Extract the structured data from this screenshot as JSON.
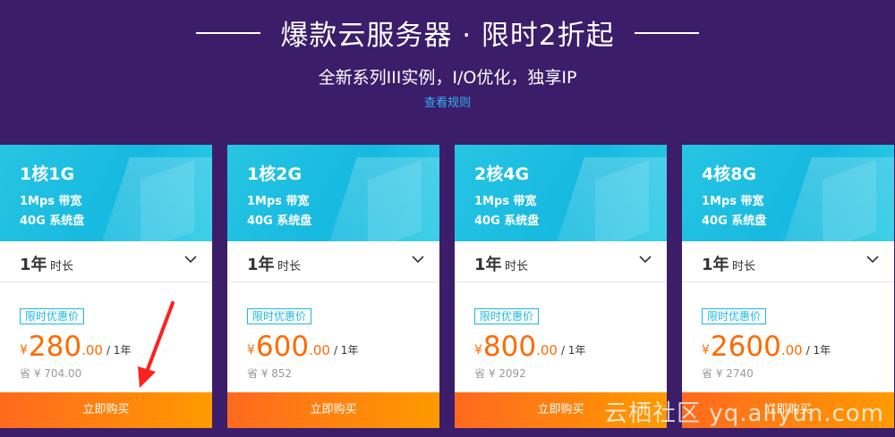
{
  "header": {
    "title": "爆款云服务器 · 限时2折起",
    "subtitle": "全新系列III实例，I/O优化，独享IP",
    "rules_link": "查看规则"
  },
  "cards": [
    {
      "spec": "1核1G",
      "bandwidth": "1Mps 带宽",
      "disk": "40G 系统盘",
      "duration_value": "1年",
      "duration_unit": "时长",
      "promo_label": "限时优惠价",
      "currency": "¥",
      "price_int": "280",
      "price_dec": ".00",
      "period": "/ 1年",
      "save_text": "省 ¥ 704.00",
      "buy_label": "立即购买"
    },
    {
      "spec": "1核2G",
      "bandwidth": "1Mps 带宽",
      "disk": "40G 系统盘",
      "duration_value": "1年",
      "duration_unit": "时长",
      "promo_label": "限时优惠价",
      "currency": "¥",
      "price_int": "600",
      "price_dec": ".00",
      "period": "/ 1年",
      "save_text": "省 ¥ 852",
      "buy_label": "立即购买"
    },
    {
      "spec": "2核4G",
      "bandwidth": "1Mps 带宽",
      "disk": "40G 系统盘",
      "duration_value": "1年",
      "duration_unit": "时长",
      "promo_label": "限时优惠价",
      "currency": "¥",
      "price_int": "800",
      "price_dec": ".00",
      "period": "/ 1年",
      "save_text": "省 ¥ 2092",
      "buy_label": "立即购买"
    },
    {
      "spec": "4核8G",
      "bandwidth": "1Mps 带宽",
      "disk": "40G 系统盘",
      "duration_value": "1年",
      "duration_unit": "时长",
      "promo_label": "限时优惠价",
      "currency": "¥",
      "price_int": "2600",
      "price_dec": ".00",
      "period": "/ 1年",
      "save_text": "省 ¥ 2740",
      "buy_label": "立即购买"
    }
  ],
  "watermark": "云栖社区 yq.aliyun.com",
  "icons": {
    "duration_toggle": "chevron-down-icon",
    "annotation": "red-arrow-icon"
  },
  "colors": {
    "background": "#3b1d6a",
    "card_header": "#16b9e0",
    "price": "#ff6a00",
    "buy_button_start": "#ff6a1e",
    "buy_button_end": "#ff9a00",
    "link": "#2fb3f0"
  }
}
